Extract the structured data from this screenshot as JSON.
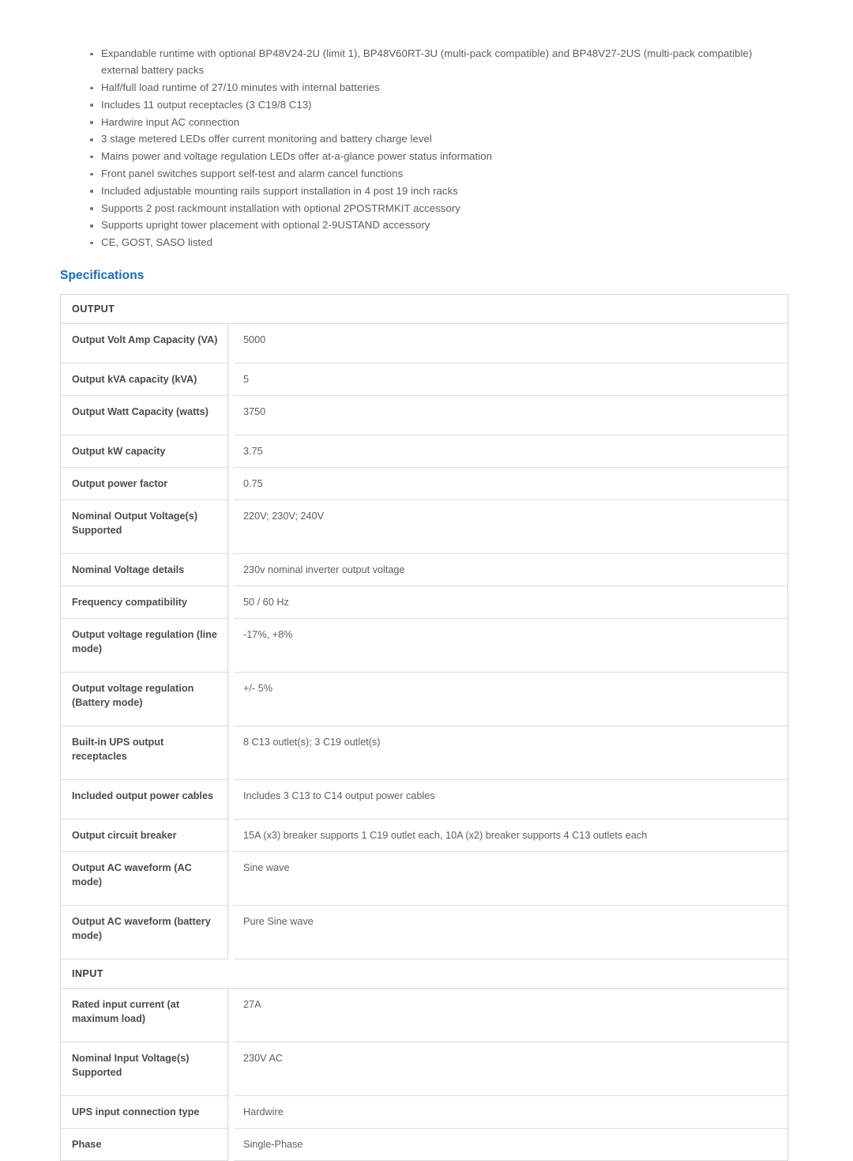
{
  "features": {
    "items": [
      "Expandable runtime with optional BP48V24-2U (limit 1), BP48V60RT-3U (multi-pack compatible) and BP48V27-2US (multi-pack compatible) external battery packs",
      "Half/full load runtime of 27/10 minutes with internal batteries",
      "Includes 11 output receptacles (3 C19/8 C13)",
      "Hardwire input AC connection",
      "3 stage metered LEDs offer current monitoring and battery charge level",
      "Mains power and voltage regulation LEDs offer at-a-glance power status information",
      "Front panel switches support self-test and alarm cancel functions",
      "Included adjustable mounting rails support installation in 4 post 19 inch racks",
      "Supports 2 post rackmount installation with optional 2POSTRMKIT accessory",
      "Supports upright tower placement with optional 2-9USTAND accessory",
      "CE, GOST, SASO listed"
    ]
  },
  "specifications": {
    "heading": "Specifications",
    "heading_color": "#1569c7",
    "sections": [
      {
        "title": "OUTPUT",
        "rows": [
          {
            "label": "Output Volt Amp Capacity (VA)",
            "value": "5000",
            "tall": true
          },
          {
            "label": "Output kVA capacity (kVA)",
            "value": "5",
            "tall": false
          },
          {
            "label": "Output Watt Capacity (watts)",
            "value": "3750",
            "tall": true
          },
          {
            "label": "Output kW capacity",
            "value": "3.75",
            "tall": false
          },
          {
            "label": "Output power factor",
            "value": "0.75",
            "tall": false
          },
          {
            "label": "Nominal Output Voltage(s) Supported",
            "value": "220V; 230V; 240V",
            "tall": true
          },
          {
            "label": "Nominal Voltage details",
            "value": "230v nominal inverter output voltage",
            "tall": false
          },
          {
            "label": "Frequency compatibility",
            "value": "50 / 60 Hz",
            "tall": false
          },
          {
            "label": "Output voltage regulation (line mode)",
            "value": "-17%, +8%",
            "tall": true
          },
          {
            "label": "Output voltage regulation (Battery mode)",
            "value": "+/- 5%",
            "tall": true
          },
          {
            "label": "Built-in UPS output receptacles",
            "value": "8 C13 outlet(s); 3 C19 outlet(s)",
            "tall": true
          },
          {
            "label": "Included output power cables",
            "value": "Includes 3 C13 to C14 output power cables",
            "tall": true
          },
          {
            "label": "Output circuit breaker",
            "value": "15A (x3) breaker supports 1 C19 outlet each, 10A (x2) breaker supports 4 C13 outlets each",
            "tall": false
          },
          {
            "label": "Output AC waveform (AC mode)",
            "value": "Sine wave",
            "tall": true
          },
          {
            "label": "Output AC waveform (battery mode)",
            "value": "Pure Sine wave",
            "tall": true
          }
        ]
      },
      {
        "title": "INPUT",
        "rows": [
          {
            "label": "Rated input current (at maximum load)",
            "value": "27A",
            "tall": true
          },
          {
            "label": "Nominal Input Voltage(s) Supported",
            "value": "230V AC",
            "tall": true
          },
          {
            "label": "UPS input connection type",
            "value": "Hardwire",
            "tall": false
          },
          {
            "label": "Phase",
            "value": "Single-Phase",
            "tall": false
          }
        ]
      }
    ]
  }
}
